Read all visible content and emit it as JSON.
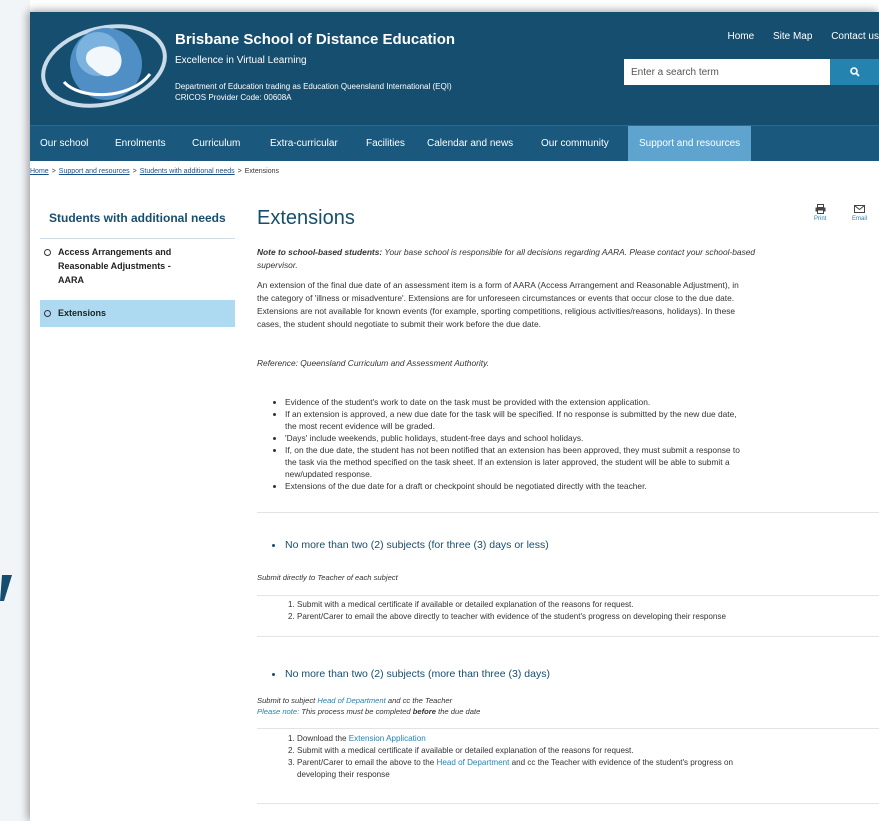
{
  "header": {
    "school_name": "Brisbane School of Distance Education",
    "tagline": "Excellence in Virtual Learning",
    "dept_line1": "Department of Education trading as Education Queensland International (EQI)",
    "dept_line2": "CRICOS Provider Code: 00608A",
    "links": [
      "Home",
      "Site Map",
      "Contact us"
    ],
    "search_placeholder": "Enter a search term",
    "search_icon": "search-icon"
  },
  "nav": [
    "Our school",
    "Enrolments",
    "Curriculum",
    "Extra-curricular",
    "Facilities",
    "Calendar and news",
    "Our community",
    "Support and resources"
  ],
  "breadcrumb": [
    "Home",
    "Support and resources",
    "Students with additional needs",
    "Extensions"
  ],
  "sidebar": {
    "title": "Students with additional needs",
    "items": [
      {
        "line1": "Access Arrangements and",
        "line2": "Reasonable Adjustments -",
        "line3": "AARA"
      },
      {
        "line1": "Extensions"
      }
    ]
  },
  "tools": {
    "print": "Print",
    "email": "Email"
  },
  "main": {
    "title": "Extensions",
    "note_label": "Note to school-based students:",
    "note_text_line1": " Your base school is responsible for all decisions regarding AARA. Please contact your school-based",
    "note_text_line2": "supervisor.",
    "para_line1": "An extension of the final due date of an assessment item is a form of AARA (Access Arrangement and Reasonable Adjustment), in",
    "para_line2": "the category of 'illness or misadventure'. Extensions are for unforeseen circumstances or events that occur close to the due date.",
    "para_line3": "Extensions are not available for known events (for example, sporting competitions, religious activities/reasons, holidays). In these",
    "para_line4": "cases, the student should negotiate to submit their work before the due date.",
    "reference": "Reference: Queensland Curriculum and Assessment Authority.",
    "bullets": [
      [
        "Evidence of the student's work to date on the task must be provided with the extension application."
      ],
      [
        "If an extension is approved, a new due date for the task will be specified. If no response is submitted by the new due date,",
        "the most recent evidence will be graded."
      ],
      [
        "'Days' include weekends, public holidays, student-free days and school holidays."
      ],
      [
        "If, on the due date, the student has not been notified that an extension has been approved, they must submit a response to",
        "the task via the method specified on the task sheet. If an extension is later approved, the student will be able to submit a",
        "new/updated response."
      ],
      [
        "Extensions of the due date for a draft or checkpoint should be negotiated directly with the teacher."
      ]
    ],
    "section1": {
      "heading": "No more than two (2) subjects (for three (3) days or less)",
      "note": "Submit directly to Teacher of each subject",
      "steps": [
        "Submit with a medical certificate if available or detailed explanation of the reasons for request.",
        "Parent/Carer to email the above directly to teacher with evidence of the student's progress on developing their response"
      ]
    },
    "section2": {
      "heading": "No more than two (2) subjects (more than three (3) days)",
      "note_pre": "Submit to subject ",
      "note_link": "Head of Department",
      "note_post": " and cc the Teacher",
      "please_label": "Please note:",
      "please_pre": " This process must be completed ",
      "please_bold": "before",
      "please_post": " the due date",
      "step1_pre": "Download the ",
      "step1_link": "Extension Application",
      "step2": "Submit with a medical certificate if available or detailed explanation of the reasons for request.",
      "step3_pre": "Parent/Carer to email the above to the ",
      "step3_link": "Head of Department",
      "step3_post": " and cc the Teacher with evidence of the student's progress on",
      "step3_line2": "developing their response"
    }
  }
}
